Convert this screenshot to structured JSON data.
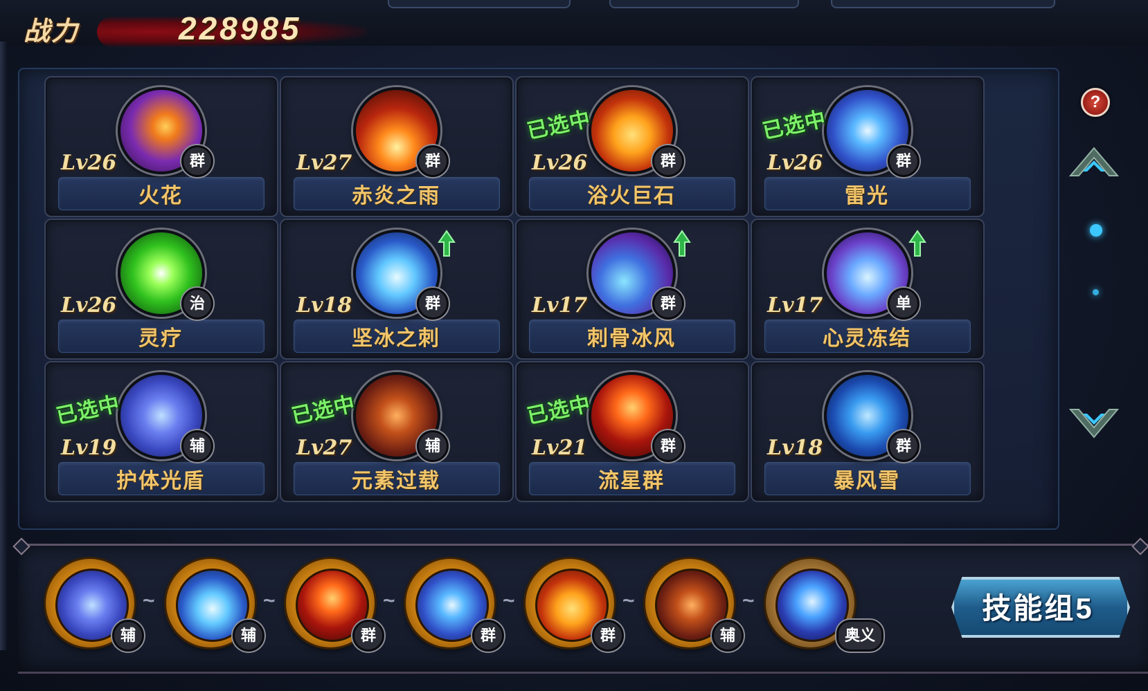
{
  "header": {
    "power_label": "战力",
    "power_value": "228985"
  },
  "skills": [
    {
      "name": "火花",
      "level": "Lv26",
      "type": "群",
      "selected": false,
      "upgrade": false,
      "theme": "fire-orb"
    },
    {
      "name": "赤炎之雨",
      "level": "Lv27",
      "type": "群",
      "selected": false,
      "upgrade": false,
      "theme": "fire-rain"
    },
    {
      "name": "浴火巨石",
      "level": "Lv26",
      "type": "群",
      "selected": true,
      "upgrade": false,
      "theme": "fire-rock"
    },
    {
      "name": "雷光",
      "level": "Lv26",
      "type": "群",
      "selected": true,
      "upgrade": false,
      "theme": "lightning"
    },
    {
      "name": "灵疗",
      "level": "Lv26",
      "type": "治",
      "selected": false,
      "upgrade": false,
      "theme": "heal"
    },
    {
      "name": "坚冰之刺",
      "level": "Lv18",
      "type": "群",
      "selected": false,
      "upgrade": true,
      "theme": "ice-spike"
    },
    {
      "name": "刺骨冰风",
      "level": "Lv17",
      "type": "群",
      "selected": false,
      "upgrade": true,
      "theme": "ice-wind"
    },
    {
      "name": "心灵冻结",
      "level": "Lv17",
      "type": "单",
      "selected": false,
      "upgrade": true,
      "theme": "mind-freeze"
    },
    {
      "name": "护体光盾",
      "level": "Lv19",
      "type": "辅",
      "selected": true,
      "upgrade": false,
      "theme": "shield"
    },
    {
      "name": "元素过载",
      "level": "Lv27",
      "type": "辅",
      "selected": true,
      "upgrade": false,
      "theme": "overload"
    },
    {
      "name": "流星群",
      "level": "Lv21",
      "type": "群",
      "selected": true,
      "upgrade": false,
      "theme": "meteor"
    },
    {
      "name": "暴风雪",
      "level": "Lv18",
      "type": "群",
      "selected": false,
      "upgrade": false,
      "theme": "blizzard"
    }
  ],
  "selected_label": "已选中",
  "skill_group": {
    "slots": [
      {
        "type": "辅",
        "theme": "shield"
      },
      {
        "type": "辅",
        "theme": "ice-spike"
      },
      {
        "type": "群",
        "theme": "meteor"
      },
      {
        "type": "群",
        "theme": "lightning"
      },
      {
        "type": "群",
        "theme": "fire-rock"
      },
      {
        "type": "辅",
        "theme": "overload"
      },
      {
        "type": "奥义",
        "theme": "ultimate"
      }
    ],
    "separator": "~",
    "button_label": "技能组5"
  },
  "side": {
    "help_icon": "question-icon",
    "scroll_up_icon": "chevron-up-icon",
    "scroll_down_icon": "chevron-down-icon"
  },
  "icons": {
    "fire-orb": "fire-orb-icon",
    "fire-rain": "fire-rain-icon",
    "fire-rock": "fire-rock-icon",
    "lightning": "lightning-icon",
    "heal": "heal-icon",
    "ice-spike": "ice-spike-icon",
    "ice-wind": "ice-wind-icon",
    "mind-freeze": "mind-freeze-icon",
    "shield": "shield-orb-icon",
    "overload": "overload-icon",
    "meteor": "meteor-icon",
    "blizzard": "blizzard-icon",
    "ultimate": "ultimate-icon"
  },
  "colors": {
    "skill_name": "#f1c56a",
    "selected": "#7df06a",
    "accent_blue": "#3cc8ff",
    "button": "#1f5c8c"
  }
}
